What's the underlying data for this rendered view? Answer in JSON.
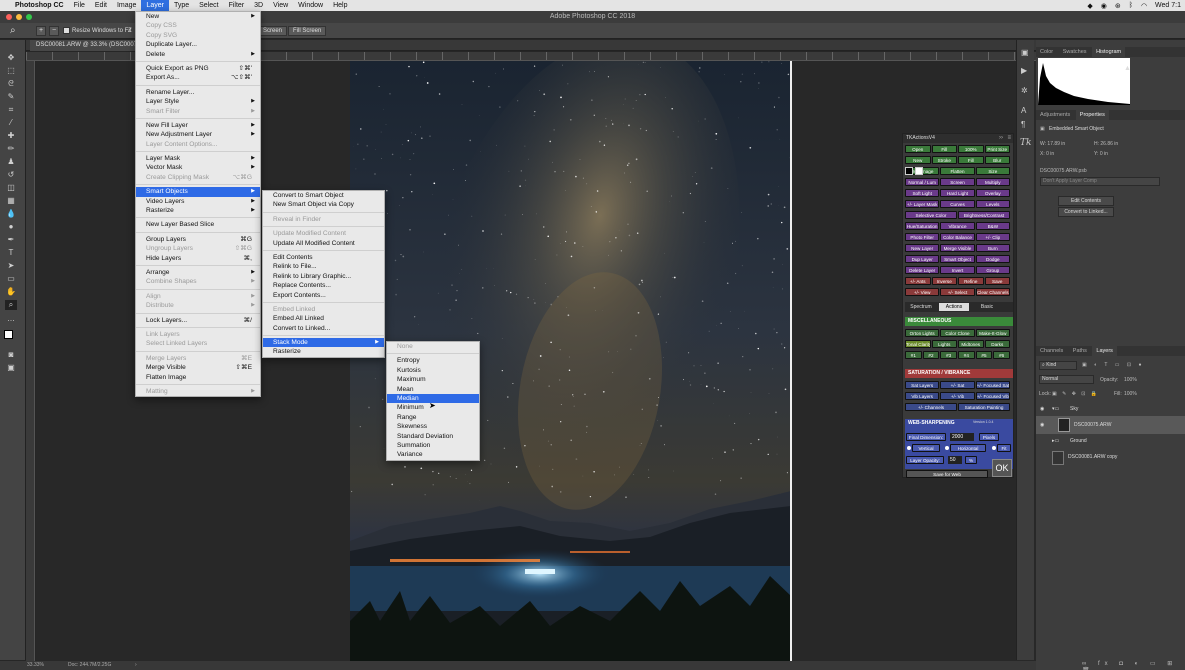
{
  "menubar": {
    "apple": "",
    "app": "Photoshop CC",
    "items": [
      "File",
      "Edit",
      "Image",
      "Layer",
      "Type",
      "Select",
      "Filter",
      "3D",
      "View",
      "Window",
      "Help"
    ],
    "active": "Layer",
    "clock": "Wed 7:1"
  },
  "window": {
    "title": "Adobe Photoshop CC 2018"
  },
  "options": {
    "resize_label": "Resize Windows to Fit",
    "zoom_prefix": "Z",
    "screen_label": "Screen",
    "fill_screen": "Fill Screen"
  },
  "doc_tab": "DSC00081.ARW @ 33.3% (DSC00075...",
  "status": {
    "zoom": "33.33%",
    "doc": "Doc: 244.7M/2.25G"
  },
  "layer_menu": {
    "items": [
      {
        "label": "New",
        "sc": "",
        "sub": true,
        "dis": false
      },
      {
        "label": "Copy CSS",
        "sc": "",
        "sub": false,
        "dis": true
      },
      {
        "label": "Copy SVG",
        "sc": "",
        "sub": false,
        "dis": true
      },
      {
        "label": "Duplicate Layer...",
        "sc": "",
        "sub": false,
        "dis": false
      },
      {
        "label": "Delete",
        "sc": "",
        "sub": true,
        "dis": false
      },
      {
        "sep": true
      },
      {
        "label": "Quick Export as PNG",
        "sc": "⇧⌘'",
        "sub": false,
        "dis": false
      },
      {
        "label": "Export As...",
        "sc": "⌥⇧⌘'",
        "sub": false,
        "dis": false
      },
      {
        "sep": true
      },
      {
        "label": "Rename Layer...",
        "sc": "",
        "sub": false,
        "dis": false
      },
      {
        "label": "Layer Style",
        "sc": "",
        "sub": true,
        "dis": false
      },
      {
        "label": "Smart Filter",
        "sc": "",
        "sub": true,
        "dis": true
      },
      {
        "sep": true
      },
      {
        "label": "New Fill Layer",
        "sc": "",
        "sub": true,
        "dis": false
      },
      {
        "label": "New Adjustment Layer",
        "sc": "",
        "sub": true,
        "dis": false
      },
      {
        "label": "Layer Content Options...",
        "sc": "",
        "sub": false,
        "dis": true
      },
      {
        "sep": true
      },
      {
        "label": "Layer Mask",
        "sc": "",
        "sub": true,
        "dis": false
      },
      {
        "label": "Vector Mask",
        "sc": "",
        "sub": true,
        "dis": false
      },
      {
        "label": "Create Clipping Mask",
        "sc": "⌥⌘G",
        "sub": false,
        "dis": true
      },
      {
        "sep": true
      },
      {
        "label": "Smart Objects",
        "sc": "",
        "sub": true,
        "dis": false,
        "sel": true
      },
      {
        "label": "Video Layers",
        "sc": "",
        "sub": true,
        "dis": false
      },
      {
        "label": "Rasterize",
        "sc": "",
        "sub": true,
        "dis": false
      },
      {
        "sep": true
      },
      {
        "label": "New Layer Based Slice",
        "sc": "",
        "sub": false,
        "dis": false
      },
      {
        "sep": true
      },
      {
        "label": "Group Layers",
        "sc": "⌘G",
        "sub": false,
        "dis": false
      },
      {
        "label": "Ungroup Layers",
        "sc": "⇧⌘G",
        "sub": false,
        "dis": true
      },
      {
        "label": "Hide Layers",
        "sc": "⌘,",
        "sub": false,
        "dis": false
      },
      {
        "sep": true
      },
      {
        "label": "Arrange",
        "sc": "",
        "sub": true,
        "dis": false
      },
      {
        "label": "Combine Shapes",
        "sc": "",
        "sub": true,
        "dis": true
      },
      {
        "sep": true
      },
      {
        "label": "Align",
        "sc": "",
        "sub": true,
        "dis": true
      },
      {
        "label": "Distribute",
        "sc": "",
        "sub": true,
        "dis": true
      },
      {
        "sep": true
      },
      {
        "label": "Lock Layers...",
        "sc": "⌘/",
        "sub": false,
        "dis": false
      },
      {
        "sep": true
      },
      {
        "label": "Link Layers",
        "sc": "",
        "sub": false,
        "dis": true
      },
      {
        "label": "Select Linked Layers",
        "sc": "",
        "sub": false,
        "dis": true
      },
      {
        "sep": true
      },
      {
        "label": "Merge Layers",
        "sc": "⌘E",
        "sub": false,
        "dis": true
      },
      {
        "label": "Merge Visible",
        "sc": "⇧⌘E",
        "sub": false,
        "dis": false
      },
      {
        "label": "Flatten Image",
        "sc": "",
        "sub": false,
        "dis": false
      },
      {
        "sep": true
      },
      {
        "label": "Matting",
        "sc": "",
        "sub": true,
        "dis": true
      }
    ]
  },
  "smart_menu": {
    "items": [
      {
        "label": "Convert to Smart Object",
        "sub": false,
        "dis": false
      },
      {
        "label": "New Smart Object via Copy",
        "sub": false,
        "dis": false
      },
      {
        "sep": true
      },
      {
        "label": "Reveal in Finder",
        "sub": false,
        "dis": true
      },
      {
        "sep": true
      },
      {
        "label": "Update Modified Content",
        "sub": false,
        "dis": true
      },
      {
        "label": "Update All Modified Content",
        "sub": false,
        "dis": false
      },
      {
        "sep": true
      },
      {
        "label": "Edit Contents",
        "sub": false,
        "dis": false
      },
      {
        "label": "Relink to File...",
        "sub": false,
        "dis": false
      },
      {
        "label": "Relink to Library Graphic...",
        "sub": false,
        "dis": false
      },
      {
        "label": "Replace Contents...",
        "sub": false,
        "dis": false
      },
      {
        "label": "Export Contents...",
        "sub": false,
        "dis": false
      },
      {
        "sep": true
      },
      {
        "label": "Embed Linked",
        "sub": false,
        "dis": true
      },
      {
        "label": "Embed All Linked",
        "sub": false,
        "dis": false
      },
      {
        "label": "Convert to Linked...",
        "sub": false,
        "dis": false
      },
      {
        "sep": true
      },
      {
        "label": "Stack Mode",
        "sub": true,
        "dis": false,
        "sel": true
      },
      {
        "label": "Rasterize",
        "sub": false,
        "dis": false
      }
    ]
  },
  "stack_menu": {
    "items": [
      {
        "label": "None",
        "dis": true
      },
      {
        "sep": true
      },
      {
        "label": "Entropy"
      },
      {
        "label": "Kurtosis"
      },
      {
        "label": "Maximum"
      },
      {
        "label": "Mean"
      },
      {
        "label": "Median",
        "sel": true
      },
      {
        "label": "Minimum"
      },
      {
        "label": "Range"
      },
      {
        "label": "Skewness"
      },
      {
        "label": "Standard Deviation"
      },
      {
        "label": "Summation"
      },
      {
        "label": "Variance"
      }
    ]
  },
  "right_panel": {
    "top_tabs": [
      "Color",
      "Swatches",
      "Histogram"
    ],
    "prop_tabs": [
      "Adjustments",
      "Properties"
    ],
    "prop_title": "Embedded Smart Object",
    "w": "W: 17.89 in",
    "h": "H: 26.86 in",
    "x": "X: 0 in",
    "y": "Y: 0 in",
    "file": "DSC00075.ARW.psb",
    "layer_comp": "Don't Apply Layer Comp",
    "edit_contents": "Edit Contents",
    "convert_linked": "Convert to Linked...",
    "layer_tabs": [
      "Channels",
      "Paths",
      "Layers"
    ],
    "kind": "Kind",
    "blend": "Normal",
    "opacity_label": "Opacity:",
    "opacity": "100%",
    "lock_label": "Lock:",
    "fill_label": "Fill:",
    "fill": "100%",
    "layers": [
      "Sky",
      "DSC00075.ARW",
      "Ground",
      "DSC00081.ARW copy"
    ]
  },
  "tk": {
    "title": "TKActionsV4",
    "rows": [
      [
        [
          "Open",
          "#3a7a3a"
        ],
        [
          "Fill",
          "#3a7a3a"
        ],
        [
          "100%",
          "#3a7a3a"
        ],
        [
          "Print Size",
          "#3a7a3a"
        ]
      ],
      [
        [
          "New",
          "#3a7a3a"
        ],
        [
          "Stroke",
          "#3a7a3a"
        ],
        [
          "Fill",
          "#3a7a3a"
        ],
        [
          "Blur",
          "#3a7a3a"
        ]
      ],
      [
        [
          "Dup Image",
          "#3a7a3a"
        ],
        [
          "Flatten",
          "#3a7a3a"
        ],
        [
          "Size",
          "#3a7a3a"
        ]
      ],
      [
        [
          "Normal / Lum",
          "#6a3a8a"
        ],
        [
          "Screen",
          "#6a3a8a"
        ],
        [
          "Multiply",
          "#6a3a8a"
        ]
      ],
      [
        [
          "Soft Light",
          "#6a3a8a"
        ],
        [
          "Hard Light",
          "#6a3a8a"
        ],
        [
          "Overlay",
          "#6a3a8a"
        ]
      ],
      [
        [
          "+/- Layer Mask",
          "#6a3a8a"
        ],
        [
          "Curves",
          "#6a3a8a"
        ],
        [
          "Levels",
          "#6a3a8a"
        ]
      ],
      [
        [
          "Selective Color",
          "#6a3a8a"
        ],
        [
          "Brightness/Contrast",
          "#6a3a8a"
        ]
      ],
      [
        [
          "Hue/Saturation",
          "#6a3a8a"
        ],
        [
          "Vibrance",
          "#6a3a8a"
        ],
        [
          "B&W",
          "#6a3a8a"
        ]
      ],
      [
        [
          "Photo Filter",
          "#6a3a8a"
        ],
        [
          "Color Balance",
          "#6a3a8a"
        ],
        [
          "+/- Clip",
          "#6a3a8a"
        ]
      ],
      [
        [
          "New Layer",
          "#6a3a8a"
        ],
        [
          "Merge Visible",
          "#6a3a8a"
        ],
        [
          "Burn",
          "#6a3a8a"
        ]
      ],
      [
        [
          "Dup Layer",
          "#6a3a8a"
        ],
        [
          "Smart Object",
          "#6a3a8a"
        ],
        [
          "Dodge",
          "#6a3a8a"
        ]
      ],
      [
        [
          "Delete Layer",
          "#6a3a8a"
        ],
        [
          "Invert",
          "#6a3a8a"
        ],
        [
          "Group",
          "#6a3a8a"
        ]
      ],
      [
        [
          "+/- Ants",
          "#8a3a3a"
        ],
        [
          "Inverse",
          "#8a3a3a"
        ],
        [
          "Refine",
          "#8a3a3a"
        ],
        [
          "Save",
          "#8a3a3a"
        ]
      ],
      [
        [
          "+/- View",
          "#8a3a3a"
        ],
        [
          "+/- Select",
          "#8a3a3a"
        ],
        [
          "Clear Channels",
          "#8a3a3a"
        ]
      ]
    ],
    "tabs": [
      "Spectrum",
      "Actions",
      "Basic"
    ],
    "misc_title": "MISCELLANEOUS",
    "misc_rows": [
      [
        [
          "Orton Lights",
          "#3a6a3a"
        ],
        [
          "Color Clone",
          "#3a6a3a"
        ],
        [
          "Make-It-Glow",
          "#3a6a3a"
        ]
      ],
      [
        [
          "Tonal Clarity",
          "#6a8a2a"
        ],
        [
          "Lights",
          "#3a6a3a"
        ],
        [
          "Midtones",
          "#3a6a3a"
        ],
        [
          "Darks",
          "#3a6a3a"
        ]
      ],
      [
        [
          "#1",
          "#3a6a3a"
        ],
        [
          "#2",
          "#3a6a3a"
        ],
        [
          "#3",
          "#3a6a3a"
        ],
        [
          "#4",
          "#3a6a3a"
        ],
        [
          "#5",
          "#3a6a3a"
        ],
        [
          "#6",
          "#3a6a3a"
        ]
      ]
    ],
    "sat_title": "SATURATION / VIBRANCE",
    "sat_rows": [
      [
        [
          "Sat Layers",
          "#3a4a8a"
        ],
        [
          "+/- Sat",
          "#3a4a8a"
        ],
        [
          "+/- Focused Sat",
          "#3a4a8a"
        ]
      ],
      [
        [
          "Vib Layers",
          "#3a4a8a"
        ],
        [
          "+/- Vib",
          "#3a4a8a"
        ],
        [
          "+/- Focused Vib",
          "#3a4a8a"
        ]
      ],
      [
        [
          "+/- Channels",
          "#3a4a8a"
        ],
        [
          "Saturation Painting",
          "#3a4a8a"
        ]
      ]
    ],
    "web_title": "WEB-SHARPENING",
    "version": "Version 1.0.4",
    "final_dim": "Final Dimension:",
    "final_val": "2000",
    "pixels": "Pixels",
    "vertical": "Vertical",
    "horizontal": "Horizontal",
    "fit": "Fit",
    "layer_opacity": "Layer Opacity:",
    "opacity_val": "50",
    "pct": "%",
    "save_web": "Save for Web",
    "ok": "OK"
  }
}
